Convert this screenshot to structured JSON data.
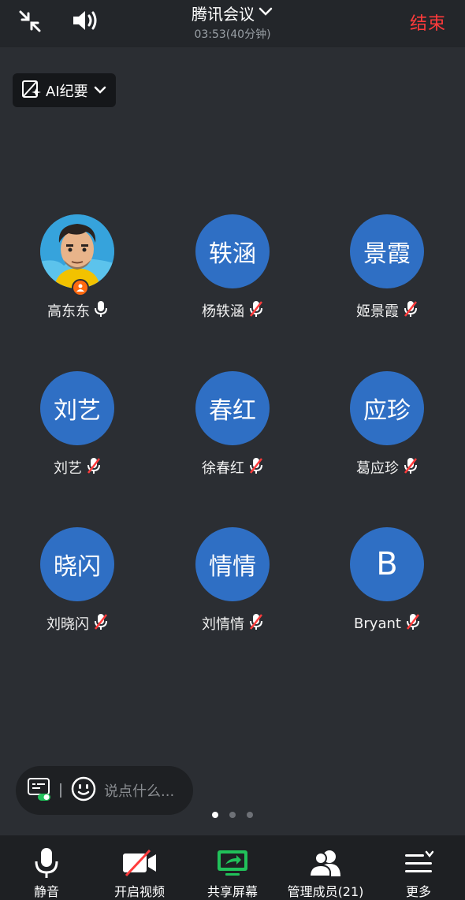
{
  "header": {
    "title": "腾讯会议",
    "subtitle": "03:53(40分钟)",
    "end_label": "结束"
  },
  "ai_badge": {
    "label": "AI纪要"
  },
  "participants": [
    {
      "avatar_text": "",
      "name": "高东东",
      "mic": "on",
      "host": true
    },
    {
      "avatar_text": "轶涵",
      "name": "杨轶涵",
      "mic": "muted"
    },
    {
      "avatar_text": "景霞",
      "name": "姬景霞",
      "mic": "muted"
    },
    {
      "avatar_text": "刘艺",
      "name": "刘艺",
      "mic": "muted"
    },
    {
      "avatar_text": "春红",
      "name": "徐春红",
      "mic": "muted"
    },
    {
      "avatar_text": "应珍",
      "name": "葛应珍",
      "mic": "muted"
    },
    {
      "avatar_text": "晓闪",
      "name": "刘晓闪",
      "mic": "muted"
    },
    {
      "avatar_text": "情情",
      "name": "刘情情",
      "mic": "muted"
    },
    {
      "avatar_text": "B",
      "name": "Bryant",
      "mic": "muted"
    }
  ],
  "chat": {
    "placeholder": "说点什么..."
  },
  "pager": {
    "pages": 3,
    "current": 1
  },
  "toolbar": {
    "mute_label": "静音",
    "video_label": "开启视频",
    "share_label": "共享屏幕",
    "members_label": "管理成员(21)",
    "more_label": "更多"
  },
  "colors": {
    "background": "#2b2e33",
    "avatar": "#2f6fc4",
    "end": "#ff3b3b",
    "share": "#21c15a",
    "muted_slash": "#ff3b3b",
    "host_badge": "#ff6a10"
  },
  "icons": [
    "collapse-icon",
    "speaker-icon",
    "chevron-down-icon",
    "ai-summary-icon",
    "mic-icon",
    "mic-muted-icon",
    "caption-icon",
    "emoji-icon",
    "video-off-icon",
    "share-screen-icon",
    "members-icon",
    "more-menu-icon",
    "host-icon"
  ]
}
